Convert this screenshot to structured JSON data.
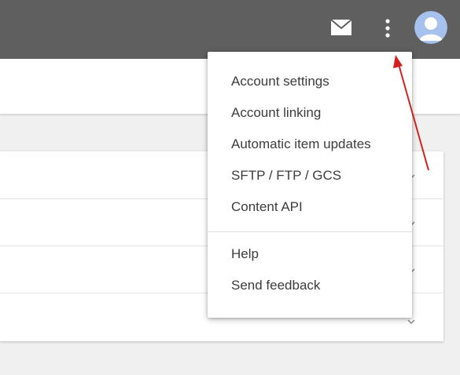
{
  "header": {
    "mail_icon": "mail-icon",
    "more_icon": "more-vert-icon",
    "avatar": "user-avatar",
    "background_color": "#5f5f5f"
  },
  "overflow_menu": {
    "items": [
      {
        "label": "Account settings"
      },
      {
        "label": "Account linking"
      },
      {
        "label": "Automatic item updates"
      },
      {
        "label": "SFTP / FTP / GCS"
      },
      {
        "label": "Content API"
      }
    ],
    "secondary_items": [
      {
        "label": "Help"
      },
      {
        "label": "Send feedback"
      }
    ]
  },
  "annotation": {
    "type": "arrow",
    "color": "#d62020",
    "points_to": "more-vert-icon"
  }
}
